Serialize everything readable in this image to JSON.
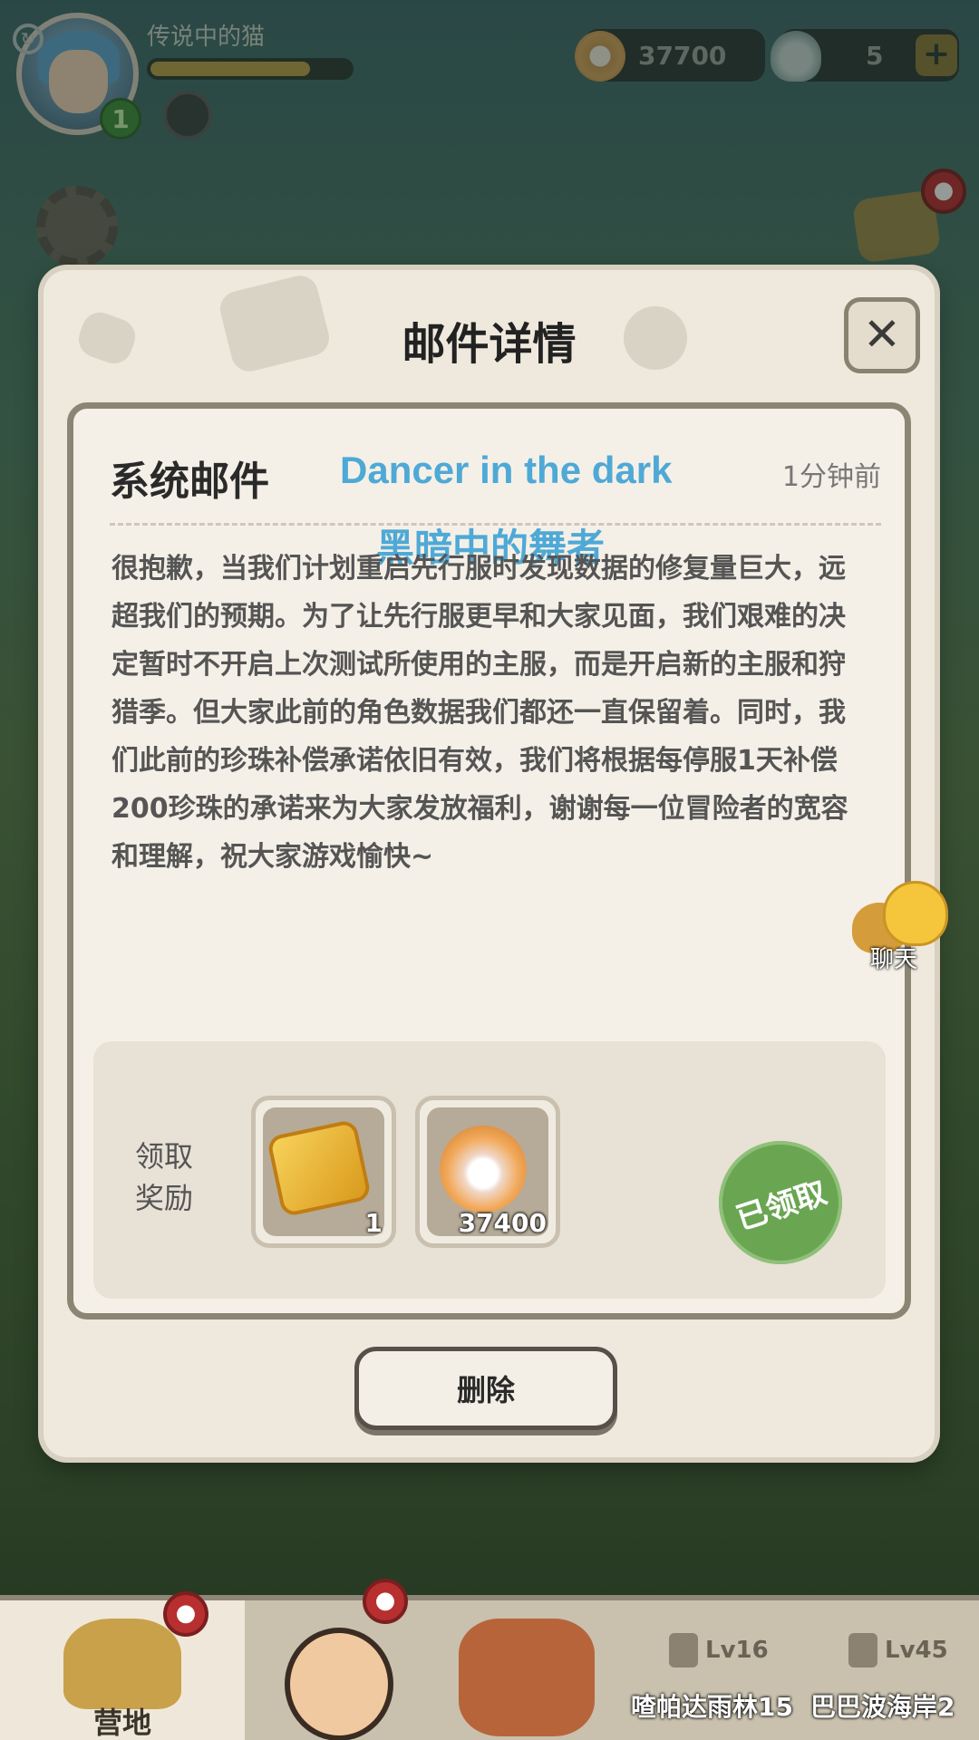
{
  "hud": {
    "player_name": "传说中的猫",
    "level": "1",
    "exp_progress": 0.8,
    "currency_pearls": "37700",
    "currency_shells": "5",
    "plus_label": "+"
  },
  "modal": {
    "title": "邮件详情",
    "close_label": "✕",
    "sender": "系统邮件",
    "time": "1分钟前",
    "watermark_en": "Dancer in the dark",
    "watermark_cn": "黑暗中的舞者",
    "body": "很抱歉，当我们计划重启先行服时发现数据的修复量巨大，远超我们的预期。为了让先行服更早和大家见面，我们艰难的决定暂时不开启上次测试所使用的主服，而是开启新的主服和狩猎季。但大家此前的角色数据我们都还一直保留着。同时，我们此前的珍珠补偿承诺依旧有效，我们将根据每停服1天补偿200珍珠的承诺来为大家发放福利，谢谢每一位冒险者的宽容和理解，祝大家游戏愉快~",
    "reward_label": "领取奖励",
    "rewards": [
      {
        "icon": "treasure-map-icon",
        "count": "1"
      },
      {
        "icon": "pearl-icon",
        "count": "37400"
      }
    ],
    "claimed_label": "已领取",
    "delete_label": "删除"
  },
  "chat": {
    "label": "聊天"
  },
  "bottom_nav": {
    "camp_label": "营地",
    "stage1_level": "Lv16",
    "stage1_name": "喳帕达雨林15",
    "stage2_level": "Lv45",
    "stage2_name": "巴巴波海岸2"
  },
  "colors": {
    "watermark": "#4ea9d6",
    "claimed_stamp": "#6aa552",
    "notification": "#b82f2f"
  }
}
